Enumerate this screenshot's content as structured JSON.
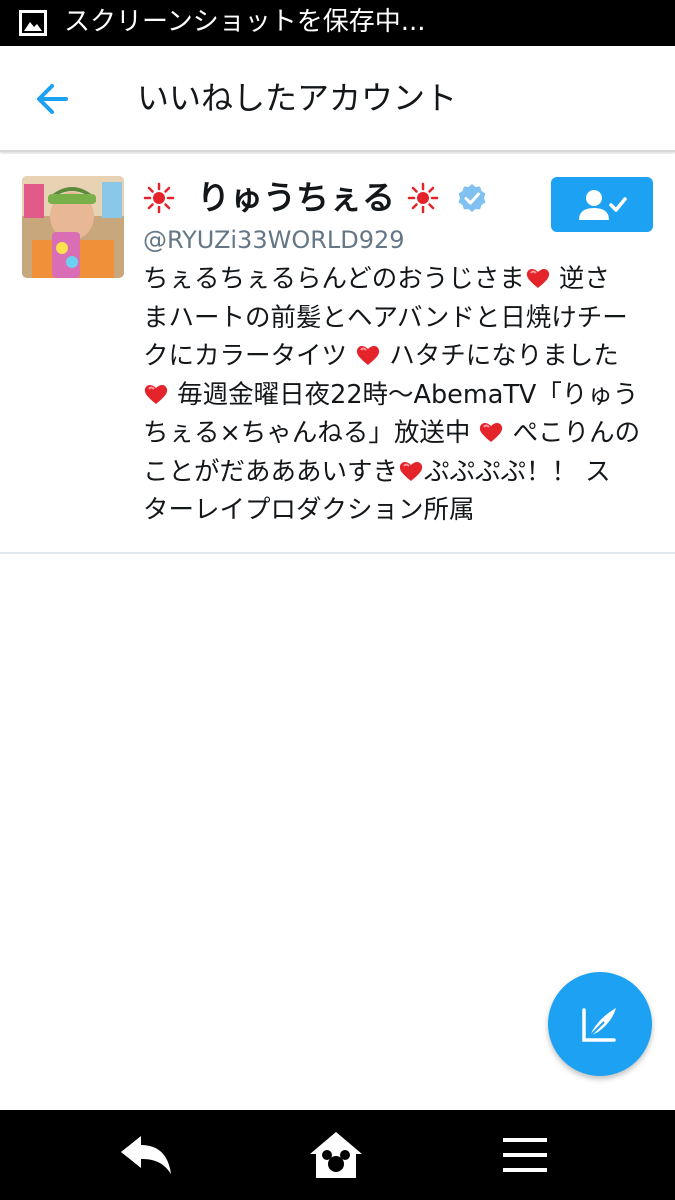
{
  "status_bar": {
    "text": "スクリーンショットを保存中...",
    "icon": "image-icon"
  },
  "header": {
    "title": "いいねしたアカウント",
    "back_icon": "back-arrow-icon",
    "accent_color": "#1da1f2"
  },
  "account": {
    "name": "りゅうちぇる",
    "handle": "@RYUZi33WORLD929",
    "verified": true,
    "following": true,
    "name_decoration_icon": "sun-emoji-icon",
    "bio_lines": [
      [
        "ちぇるちぇるらんどのおうじさま",
        "heart",
        " 逆さ"
      ],
      [
        "まハートの前髪とヘアバンドと日焼けチー"
      ],
      [
        "クにカラータイツ ",
        "heart",
        " ハタチになりました"
      ],
      [
        "heart",
        " 毎週金曜日夜22時〜AbemaTV「りゅう"
      ],
      [
        "ちぇる×ちゃんねる」放送中 ",
        "heart",
        " ぺこりんの"
      ],
      [
        "ことがだあああいすき",
        "heart",
        "ぷぷぷぷ！！ ス"
      ],
      [
        "ターレイプロダクション所属"
      ]
    ]
  },
  "fab": {
    "icon": "compose-tweet-icon"
  },
  "nav_bar": {
    "icons": [
      "back-icon",
      "home-icon",
      "menu-icon"
    ]
  }
}
